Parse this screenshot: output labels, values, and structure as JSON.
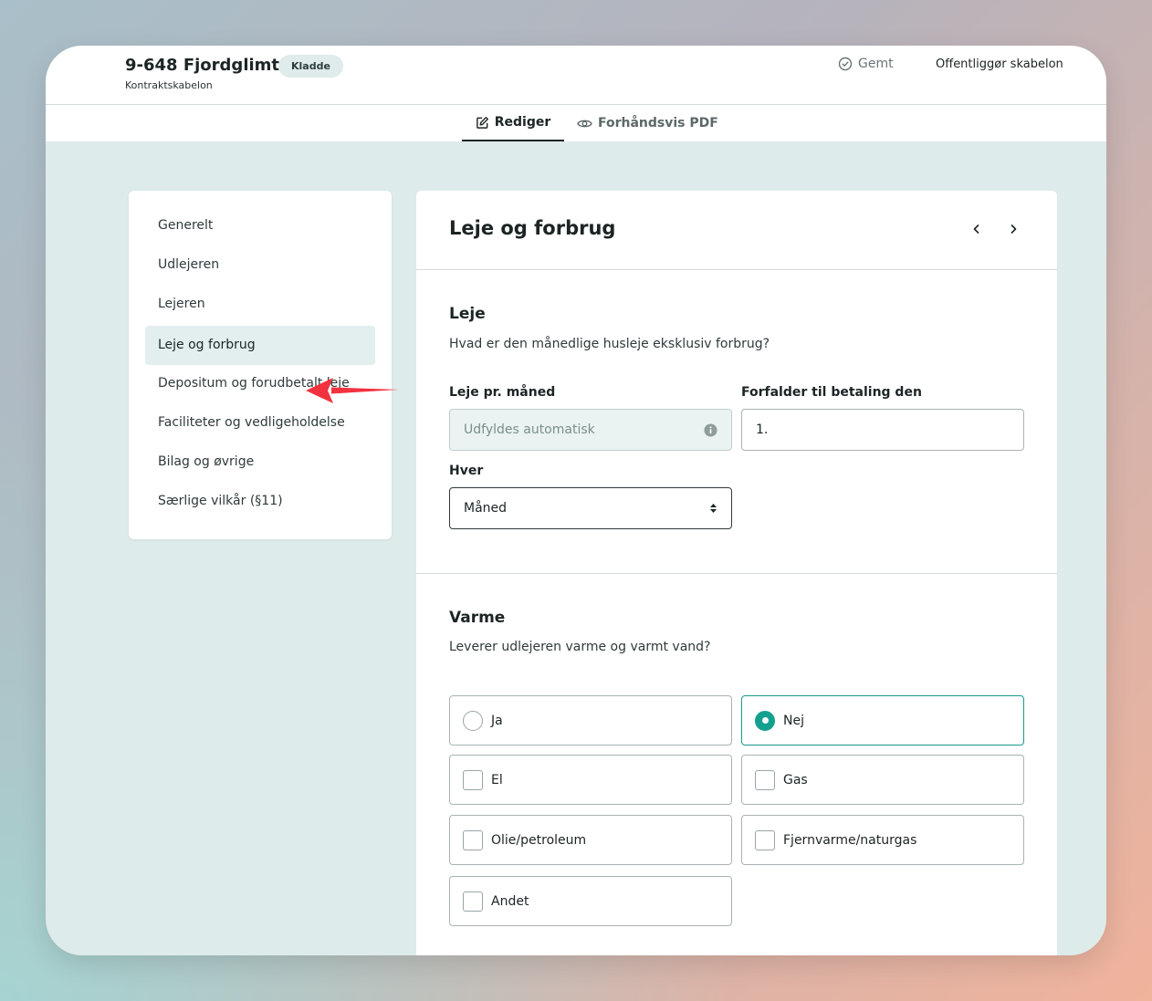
{
  "header": {
    "title": "9-648 Fjordglimt",
    "subtitle": "Kontraktskabelon",
    "badge": "Kladde",
    "saved_label": "Gemt",
    "publish_label": "Offentliggør skabelon"
  },
  "tabs": {
    "edit_label": "Rediger",
    "preview_label": "Forhåndsvis PDF"
  },
  "sidebar": {
    "items": [
      {
        "label": "Generelt"
      },
      {
        "label": "Udlejeren"
      },
      {
        "label": "Lejeren"
      },
      {
        "label": "Leje og forbrug",
        "active": true
      },
      {
        "label": "Depositum og forudbetalt leje"
      },
      {
        "label": "Faciliteter og vedligeholdelse"
      },
      {
        "label": "Bilag og øvrige"
      },
      {
        "label": "Særlige vilkår (§11)"
      }
    ]
  },
  "panel": {
    "title": "Leje og forbrug",
    "leje": {
      "title": "Leje",
      "description": "Hvad er den månedlige husleje eksklusiv forbrug?",
      "rent_label": "Leje pr. måned",
      "rent_placeholder": "Udfyldes automatisk",
      "due_label": "Forfalder til betaling den",
      "due_value": "1.",
      "every_label": "Hver",
      "every_value": "Måned"
    },
    "varme": {
      "title": "Varme",
      "description": "Leverer udlejeren varme og varmt vand?",
      "radio_yes": "Ja",
      "radio_no": "Nej",
      "selected": "Nej",
      "options": [
        "El",
        "Gas",
        "Olie/petroleum",
        "Fjernvarme/naturgas",
        "Andet"
      ]
    }
  },
  "colors": {
    "accent": "#14a08f",
    "annotation_arrow": "#f2323f",
    "background": "#ddebea"
  }
}
